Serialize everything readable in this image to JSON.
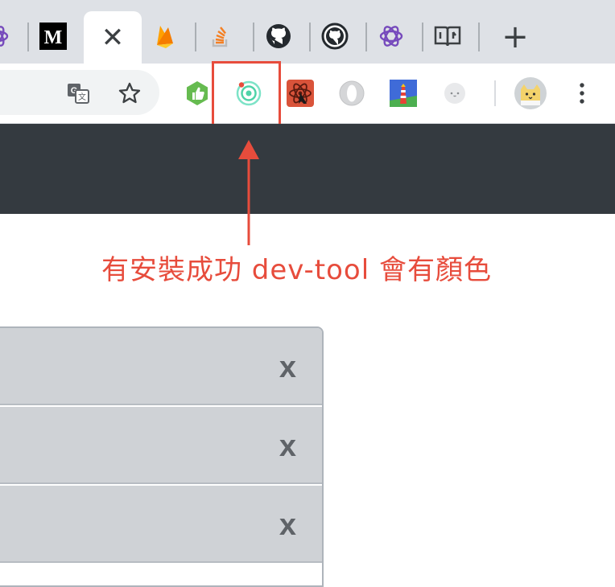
{
  "browser": {
    "tabs": [
      {
        "icon": "redux-icon",
        "active": false
      },
      {
        "icon": "medium-icon",
        "active": false
      },
      {
        "icon": "close-icon",
        "active": true,
        "close_label": "✕"
      },
      {
        "icon": "firebase-icon",
        "active": false
      },
      {
        "icon": "stackoverflow-icon",
        "active": false
      },
      {
        "icon": "github-icon",
        "active": false
      },
      {
        "icon": "github-icon",
        "active": false
      },
      {
        "icon": "redux-icon",
        "active": false
      },
      {
        "icon": "gitbook-icon",
        "active": false
      }
    ],
    "new_tab_label": "+",
    "toolbar_icons": [
      "translate-icon",
      "star-icon",
      "thumbs-up-extension-icon",
      "ionic-devtools-extension-icon",
      "react-devtools-extension-icon",
      "opera-extension-icon",
      "lighthouse-extension-icon",
      "extension-icon",
      "profile-avatar-icon",
      "menu-kebab-icon"
    ]
  },
  "annotation": {
    "text": "有安裝成功 dev-tool 會有顏色",
    "color": "#e74c3c"
  },
  "page": {
    "navbar_color": "#343a40",
    "list_items": [
      {
        "remove_label": "x"
      },
      {
        "remove_label": "x"
      },
      {
        "remove_label": "x"
      }
    ]
  }
}
